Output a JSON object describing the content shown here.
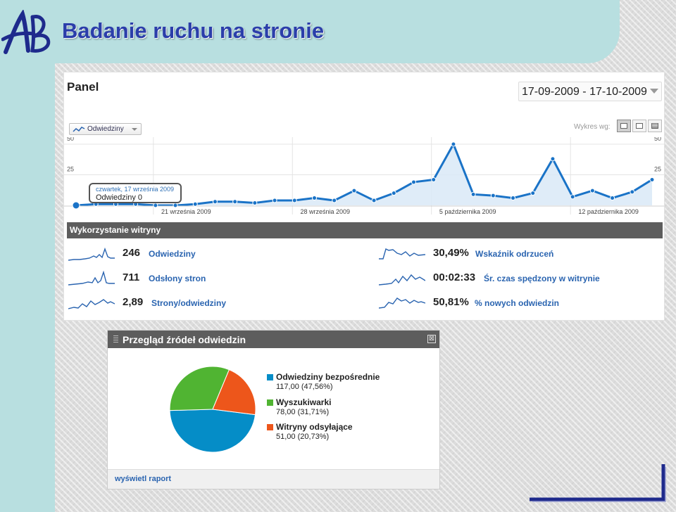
{
  "slide": {
    "title": "Badanie ruchu na stronie",
    "logo_text": "AB"
  },
  "panel": {
    "title": "Panel",
    "date_range": "17-09-2009 - 17-10-2009",
    "metric_select": "Odwiedziny",
    "chart_by_label": "Wykres wg:",
    "tooltip": {
      "date": "czwartek, 17 września 2009",
      "value": "Odwiedziny 0"
    }
  },
  "chart_data": {
    "type": "area",
    "series": [
      {
        "name": "Odwiedziny",
        "values": [
          0,
          1,
          1,
          1,
          0,
          0,
          1,
          3,
          3,
          2,
          4,
          4,
          6,
          4,
          12,
          4,
          10,
          19,
          21,
          50,
          9,
          8,
          6,
          10,
          38,
          7,
          12,
          6,
          11,
          21
        ]
      }
    ],
    "ylim": [
      0,
      50
    ],
    "y_ticks": [
      "50",
      "25"
    ],
    "x_tick_labels": [
      "21 września 2009",
      "28 września 2009",
      "5 października 2009",
      "12 października 2009"
    ],
    "grid": true,
    "highlight_point": {
      "date": "czwartek, 17 września 2009",
      "value": 0
    }
  },
  "usage": {
    "title": "Wykorzystanie witryny",
    "stats": [
      {
        "value": "246",
        "label": "Odwiedziny"
      },
      {
        "value": "711",
        "label": "Odsłony stron"
      },
      {
        "value": "2,89",
        "label": "Strony/odwiedziny"
      },
      {
        "value": "30,49%",
        "label": "Wskaźnik odrzuceń"
      },
      {
        "value": "00:02:33",
        "label": "Śr. czas spędzony w witrynie"
      },
      {
        "value": "50,81%",
        "label": "% nowych odwiedzin"
      }
    ]
  },
  "sources": {
    "title": "Przegląd źródeł odwiedzin",
    "close_glyph": "⊠",
    "link": "wyświetl raport",
    "items": [
      {
        "name": "Odwiedziny bezpośrednie",
        "detail": "117,00 (47,56%)",
        "value": 117.0,
        "percent": 47.56,
        "color": "#058dc7"
      },
      {
        "name": "Wyszukiwarki",
        "detail": "78,00 (31,71%)",
        "value": 78.0,
        "percent": 31.71,
        "color": "#50b432"
      },
      {
        "name": "Witryny odsyłające",
        "detail": "51,00 (20,73%)",
        "value": 51.0,
        "percent": 20.73,
        "color": "#ed561b"
      }
    ]
  },
  "colors": {
    "line": "#1a73c7",
    "fill": "#d9e9f7",
    "title": "#2b3eaa",
    "band": "#b8dfe0"
  }
}
